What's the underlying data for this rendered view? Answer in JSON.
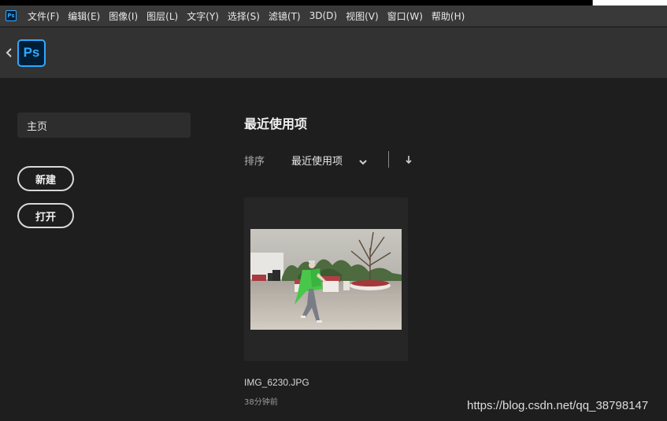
{
  "app": {
    "icon_text": "Ps",
    "logo_text": "Ps"
  },
  "menu": [
    "文件(F)",
    "编辑(E)",
    "图像(I)",
    "图层(L)",
    "文字(Y)",
    "选择(S)",
    "滤镜(T)",
    "3D(D)",
    "视图(V)",
    "窗口(W)",
    "帮助(H)"
  ],
  "sidebar": {
    "home_label": "主页",
    "new_label": "新建",
    "open_label": "打开"
  },
  "recent": {
    "title": "最近使用项",
    "sort_label": "排序",
    "sort_value": "最近使用项",
    "files": [
      {
        "name": "IMG_6230.JPG",
        "time": "38分钟前"
      }
    ]
  },
  "watermark": "https://blog.csdn.net/qq_38798147",
  "colors": {
    "accent": "#31a8ff",
    "logo_bg": "#001e36",
    "background": "#1e1e1e",
    "header": "#323232",
    "menubar": "#393939"
  },
  "icons": {
    "back": "chevron-left-icon",
    "sort_dropdown": "chevron-down-icon",
    "sort_direction": "arrow-down-icon"
  }
}
